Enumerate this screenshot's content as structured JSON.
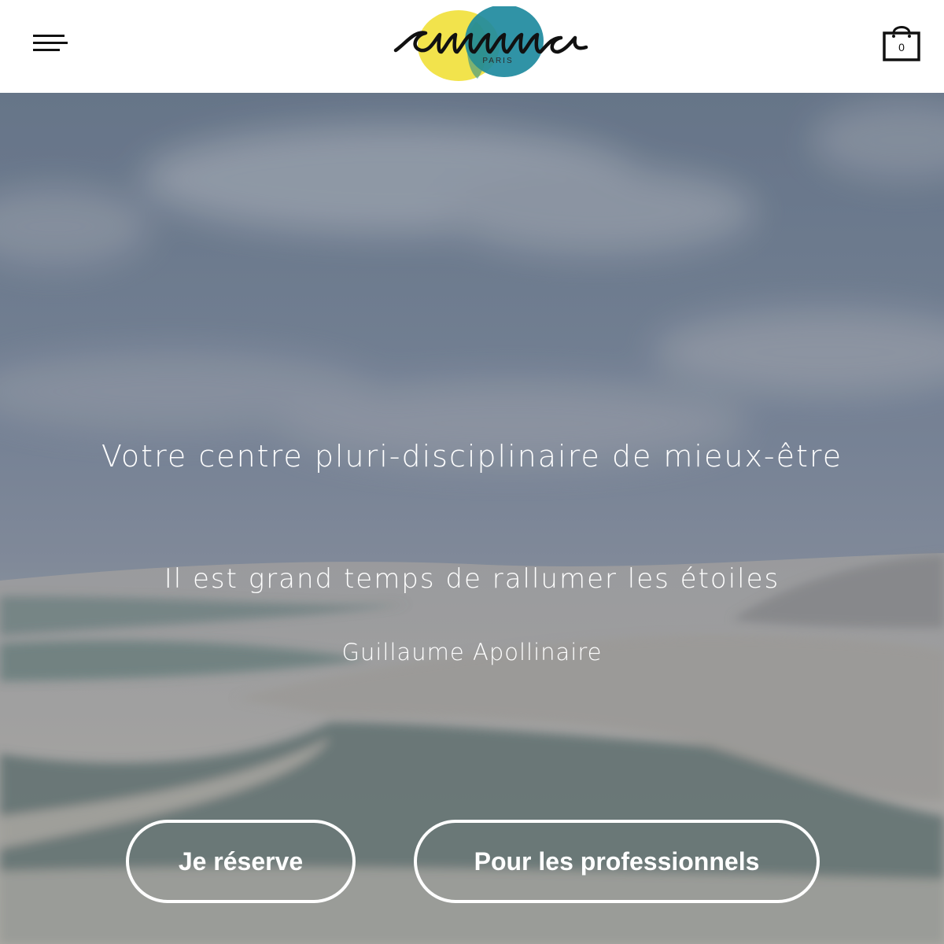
{
  "header": {
    "menu_icon": "hamburger-menu-icon",
    "logo": {
      "text": "emma",
      "subtext": "PARIS",
      "colors": {
        "yellow": "#F2E34C",
        "teal": "#1E8A9E"
      }
    },
    "cart": {
      "icon": "shopping-bag-icon",
      "count": "0"
    }
  },
  "hero": {
    "headline": "Votre centre pluri-disciplinaire de mieux-être",
    "quote": "Il est grand temps de rallumer les étoiles",
    "author": "Guillaume Apollinaire",
    "buttons": {
      "reserve": "Je réserve",
      "professionals": "Pour les professionnels"
    }
  }
}
